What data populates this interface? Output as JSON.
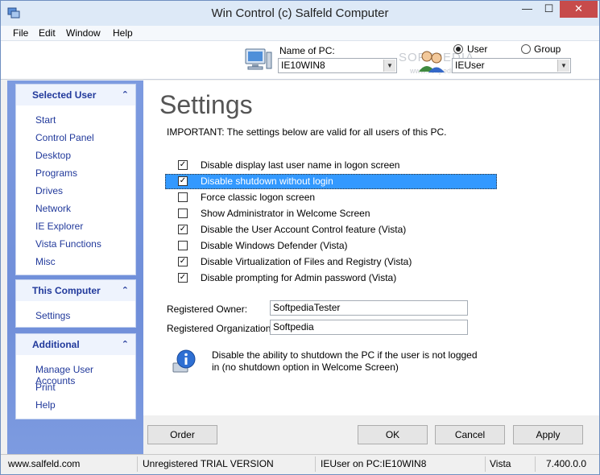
{
  "window": {
    "title": "Win Control (c) Salfeld Computer",
    "minimize": "—",
    "maximize": "☐",
    "close": "✕"
  },
  "menu": [
    "File",
    "Edit",
    "Window",
    "Help"
  ],
  "header": {
    "pc_label": "Name of PC:",
    "pc_value": "IE10WIN8",
    "radio_user": "User",
    "radio_group": "Group",
    "user_value": "IEUser",
    "watermark": "SOFTPEDIA",
    "watermark_url": "www.softpedia.com"
  },
  "sidebar": {
    "selected_user": {
      "title": "Selected User",
      "items": [
        "Start",
        "Control Panel",
        "Desktop",
        "Programs",
        "Drives",
        "Network",
        "IE Explorer",
        "Vista Functions",
        "Misc"
      ]
    },
    "this_computer": {
      "title": "This Computer",
      "items": [
        "Settings"
      ]
    },
    "additional": {
      "title": "Additional",
      "items": [
        "Manage User Accounts",
        "Print",
        "Help"
      ]
    }
  },
  "content": {
    "heading": "Settings",
    "important": "IMPORTANT: The settings below are valid for all users of this PC.",
    "options": [
      {
        "label": "Disable display last user name in logon screen",
        "checked": true
      },
      {
        "label": "Disable shutdown without login",
        "checked": true
      },
      {
        "label": "Force classic logon screen",
        "checked": false
      },
      {
        "label": "Show Administrator in Welcome Screen",
        "checked": false
      },
      {
        "label": "Disable the User Account Control feature (Vista)",
        "checked": true
      },
      {
        "label": "Disable Windows Defender (Vista)",
        "checked": false
      },
      {
        "label": "Disable Virtualization of Files and Registry (Vista)",
        "checked": true
      },
      {
        "label": "Disable prompting for Admin password (Vista)",
        "checked": true
      }
    ],
    "owner_label": "Registered Owner:",
    "owner_value": "SoftpediaTester",
    "org_label": "Registered Organization:",
    "org_value": "Softpedia",
    "info": "Disable the ability to shutdown the PC if the user is not logged in (no shutdown option in Welcome Screen)"
  },
  "buttons": {
    "order": "Order",
    "ok": "OK",
    "cancel": "Cancel",
    "apply": "Apply"
  },
  "status": {
    "site": "www.salfeld.com",
    "license": "Unregistered TRIAL VERSION",
    "session": "IEUser on PC:IE10WIN8",
    "os": "Vista",
    "version": "7.400.0.0"
  },
  "colors": {
    "sidebar": "#7d9be0",
    "link": "#21399b",
    "selection": "#3399ff"
  }
}
